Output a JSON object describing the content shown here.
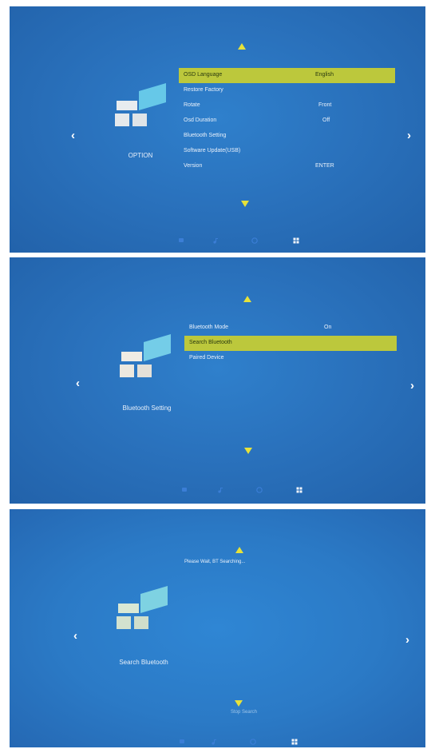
{
  "panels": [
    {
      "caption": "OPTION",
      "menu": [
        {
          "label": "OSD Language",
          "value": "English",
          "selected": true
        },
        {
          "label": "Restore Factory",
          "value": "",
          "selected": false
        },
        {
          "label": "Rotate",
          "value": "Front",
          "selected": false
        },
        {
          "label": "Osd Duration",
          "value": "Off",
          "selected": false
        },
        {
          "label": "Bluetooth Setting",
          "value": "",
          "selected": false
        },
        {
          "label": "Software Update(USB)",
          "value": "",
          "selected": false
        },
        {
          "label": "Version",
          "value": "ENTER",
          "selected": false
        }
      ]
    },
    {
      "caption": "Bluetooth Setting",
      "menu": [
        {
          "label": "Bluetooth Mode",
          "value": "On",
          "selected": false
        },
        {
          "label": "Search Bluetooth",
          "value": "",
          "selected": true
        },
        {
          "label": "Paired Device",
          "value": "",
          "selected": false
        }
      ]
    },
    {
      "caption": "Search Bluetooth",
      "status": "Please Wait, BT Searching...",
      "stop_label": "Stop Search"
    }
  ],
  "bottom_icons": [
    "picture-icon",
    "music-icon",
    "time-icon",
    "option-icon"
  ],
  "active_icon": "option-icon",
  "colors": {
    "highlight": "#bcc83c",
    "arrow": "#e6e23a",
    "background": "#2a72bd"
  }
}
